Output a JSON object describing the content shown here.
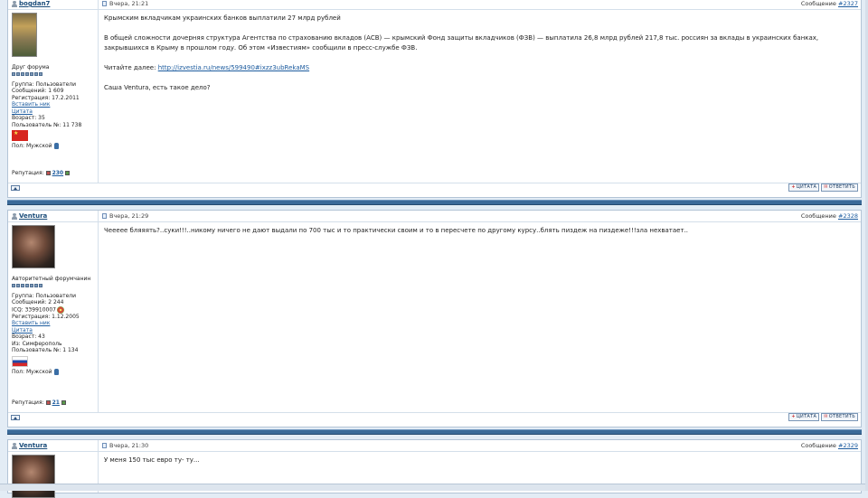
{
  "posts": [
    {
      "nick": "bogdan7",
      "date": "Вчера, 21:21",
      "msg_prefix": "Сообщение",
      "msg_link": "#2327",
      "user_title": "Друг форума",
      "pips": 7,
      "info": {
        "group": "Группа: Пользователи",
        "messages": "Сообщений: 1 609",
        "registered": "Регистрация: 17.2.2011",
        "insert_nick": "Вставить ник",
        "quote": "Цитата",
        "age": "Возраст: 35",
        "user_no": "Пользователь №: 11 738",
        "gender": "Пол: Мужской"
      },
      "reputation_label": "Репутация:",
      "reputation_value": "230",
      "body": [
        "Крымским вкладчикам украинских банков выплатили 27 млрд рублей",
        "",
        "В общей сложности дочерняя структура Агентства по страхованию вкладов (АСВ) — крымский Фонд защиты вкладчиков (ФЗВ) — выплатила 26,8 млрд рублей 217,8 тыс. россиян за вклады в украинских банках, закрывшихся в Крыму в прошлом году. Об этом «Известиям» сообщили в пресс-службе ФЗВ.",
        "",
        "Читайте далее:",
        "",
        "Саша Ventura, есть такое дело?"
      ],
      "link": "http://izvestia.ru/news/599490#ixzz3ubRekaMS"
    },
    {
      "nick": "Ventura",
      "date": "Вчера, 21:29",
      "msg_prefix": "Сообщение",
      "msg_link": "#2328",
      "user_title": "Авторитетный форумчанин",
      "pips": 7,
      "info": {
        "group": "Группа: Пользователи",
        "messages": "Сообщений: 2 244",
        "icq": "ICQ: 339910007",
        "registered": "Регистрация: 1.12.2005",
        "insert_nick": "Вставить ник",
        "quote": "Цитата",
        "age": "Возраст: 43",
        "from": "Из: Симферополь",
        "user_no": "Пользователь №: 1 134",
        "gender": "Пол: Мужской"
      },
      "reputation_label": "Репутация:",
      "reputation_value": "21",
      "body": [
        "Чеееее бляяять?..суки!!!..никому ничего не дают выдали по 700 тыс и то практически своим и то в пересчете по другому курсу..блять пиздеж на пиздеже!!!зла нехватает.."
      ]
    },
    {
      "nick": "Ventura",
      "date": "Вчера, 21:30",
      "msg_prefix": "Сообщение",
      "msg_link": "#2329",
      "body": [
        "У меня 150 тыс евро ту- ту..."
      ]
    }
  ],
  "buttons": {
    "quote": "ЦИТАТА",
    "reply": "ОТВЕТИТЬ"
  },
  "colors": {
    "separator": "#3b6a98",
    "link": "#1d5c9f",
    "nick": "#1c4d7a"
  }
}
